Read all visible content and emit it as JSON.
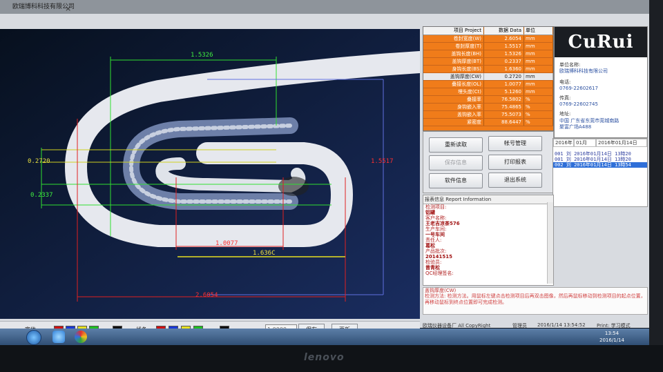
{
  "window": {
    "title": "欧瑞博科科技有限公司",
    "close_glyph": "×"
  },
  "measurements": {
    "top_width": "1.5326",
    "left_upper": "0.2720",
    "left_lower": "0.2337",
    "right_height": "1.5517",
    "inner_length": "1.0077",
    "mid_length": "1.636C",
    "bottom_length": "2.6054"
  },
  "toolbar": {
    "font_label": "字体:",
    "line_label": "线条:",
    "font_colors": [
      "#d01010",
      "#1838d8",
      "#e8e020",
      "#20c020",
      "#101010"
    ],
    "line_colors": [
      "#d01010",
      "#1838d8",
      "#e8e020",
      "#20c020",
      "#101010"
    ],
    "value_input": "1.0000",
    "save_label": "保存",
    "more_label": "更新"
  },
  "data_table": {
    "headers": [
      "项目 Project",
      "数据 Data",
      "单位"
    ],
    "rows": [
      {
        "item": "卷封宽度(W)",
        "value": "2.6054",
        "unit": "mm"
      },
      {
        "item": "卷封厚度(T)",
        "value": "1.5517",
        "unit": "mm"
      },
      {
        "item": "盖钩长度(BH)",
        "value": "1.5326",
        "unit": "mm"
      },
      {
        "item": "盖钩厚度(BT)",
        "value": "0.2337",
        "unit": "mm"
      },
      {
        "item": "身钩长度(BS)",
        "value": "1.6360",
        "unit": "mm"
      },
      {
        "item": "盖钩厚度(CW)",
        "value": "0.2720",
        "unit": "mm"
      },
      {
        "item": "叠接长度(OL)",
        "value": "1.0077",
        "unit": "mm"
      },
      {
        "item": "埋头度(Ct)",
        "value": "5.1260",
        "unit": "mm"
      },
      {
        "item": "叠接率",
        "value": "76.5802",
        "unit": "%"
      },
      {
        "item": "身钩嵌入率",
        "value": "75.4865",
        "unit": "%"
      },
      {
        "item": "盖钩嵌入率",
        "value": "75.5073",
        "unit": "%"
      },
      {
        "item": "紧密度",
        "value": "88.6447",
        "unit": "%"
      }
    ],
    "selected_index": 5
  },
  "company": {
    "logo": "CuRui",
    "name_label": "单位名称:",
    "name": "欧瑞博科科技有限公司",
    "phone_label": "电话:",
    "phone": "0769-22602617",
    "fax_label": "传真:",
    "fax": "0769-22602745",
    "addr_label": "地址:",
    "addr1": "中国 广东省东莞市莞城南路",
    "addr2": "聚富广场A488"
  },
  "buttons": {
    "reload": "重新读取",
    "account": "帐号管理",
    "save_info": "保存信息",
    "print": "打印报表",
    "software": "软件信息",
    "exit": "退出系统"
  },
  "records": {
    "year": "2016年",
    "month": "01月",
    "date": "2016年01月14日",
    "rows": [
      "001 刘 2016年01月14日 13時20",
      "001 刘 2016年01月14日 13時20",
      "002 刘 2016年01月14日 13時54"
    ],
    "selected_index": 2
  },
  "report": {
    "title": "报表信息 Report Information",
    "lines": [
      {
        "label": "检测项目:",
        "value": "铝罐"
      },
      {
        "label": "客户名称:",
        "value": "王老吉凉茶576"
      },
      {
        "label": "生产车间:",
        "value": "一号车间"
      },
      {
        "label": "责任人:",
        "value": "葛松"
      },
      {
        "label": "产品批次:",
        "value": "20141515"
      },
      {
        "label": "检验员:",
        "value": "曾青松"
      },
      {
        "label": "QC经理签名:",
        "value": ""
      }
    ]
  },
  "notice": {
    "title": "盖钩厚度(CW)",
    "text": "检测方法: 检测方法。用鼠标左键点击检测项目后再双击图像，然后再鼠标移动到检测项目的起点位置，再移动鼠标到终点位置即可完成检测。"
  },
  "status": {
    "company": "欧瑞仪器设备厂 All CopyRight",
    "user": "管理员",
    "datetime": "2016/1/14 13:54:52",
    "print": "Print: 学习模式"
  },
  "taskbar": {
    "time": "13:54",
    "date": "2016/1/14"
  },
  "monitor_brand": "lenovo"
}
